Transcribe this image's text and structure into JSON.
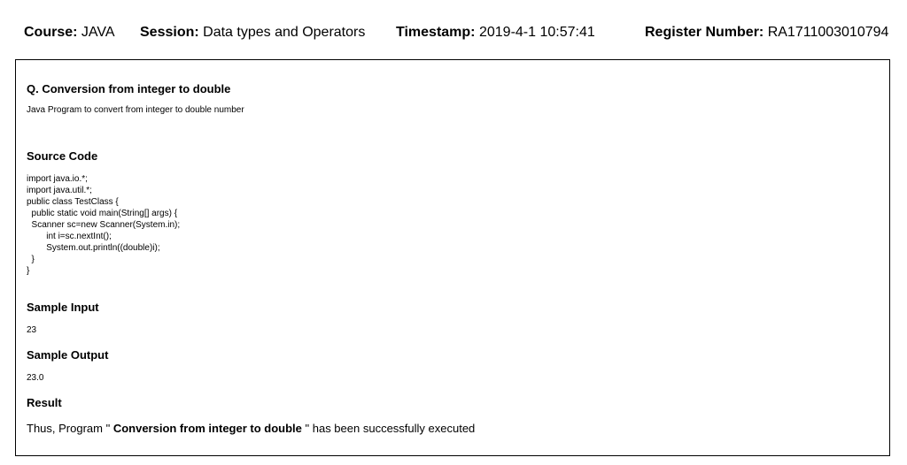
{
  "header": {
    "course_label": "Course:",
    "course_value": "JAVA",
    "session_label": "Session:",
    "session_value": "Data types and Operators",
    "timestamp_label": "Timestamp:",
    "timestamp_value": "2019-4-1 10:57:41",
    "register_label": "Register Number:",
    "register_value": "RA1711003010794"
  },
  "question": {
    "title": "Q. Conversion from integer to double",
    "description": "Java Program to convert from integer to double number"
  },
  "source": {
    "heading": "Source Code",
    "code": "import java.io.*;\nimport java.util.*;\npublic class TestClass {\n  public static void main(String[] args) {\n  Scanner sc=new Scanner(System.in);\n        int i=sc.nextInt();\n        System.out.println((double)i);\n  }\n}"
  },
  "sample_input": {
    "heading": "Sample Input",
    "value": "23"
  },
  "sample_output": {
    "heading": "Sample Output",
    "value": "23.0"
  },
  "result": {
    "heading": "Result",
    "prefix": "Thus, Program \" ",
    "program_name": "Conversion from integer to double",
    "suffix": " \" has been successfully executed"
  }
}
